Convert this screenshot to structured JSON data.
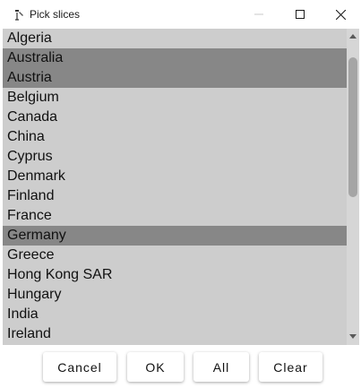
{
  "window": {
    "title": "Pick slices",
    "icon": "app-pen-icon",
    "controls": [
      "minimize-icon",
      "maximize-icon",
      "close-icon"
    ]
  },
  "list": {
    "items": [
      {
        "label": "Algeria",
        "selected": false
      },
      {
        "label": "Australia",
        "selected": true
      },
      {
        "label": "Austria",
        "selected": true
      },
      {
        "label": "Belgium",
        "selected": false
      },
      {
        "label": "Canada",
        "selected": false
      },
      {
        "label": "China",
        "selected": false
      },
      {
        "label": "Cyprus",
        "selected": false
      },
      {
        "label": "Denmark",
        "selected": false
      },
      {
        "label": "Finland",
        "selected": false
      },
      {
        "label": "France",
        "selected": false
      },
      {
        "label": "Germany",
        "selected": true
      },
      {
        "label": "Greece",
        "selected": false
      },
      {
        "label": "Hong Kong SAR",
        "selected": false
      },
      {
        "label": "Hungary",
        "selected": false
      },
      {
        "label": "India",
        "selected": false
      },
      {
        "label": "Ireland",
        "selected": false
      }
    ]
  },
  "buttons": {
    "cancel": "Cancel",
    "ok": "OK",
    "all": "All",
    "clear": "Clear"
  },
  "colors": {
    "list_background": "#cdcdcd",
    "selected_background": "#878787"
  }
}
